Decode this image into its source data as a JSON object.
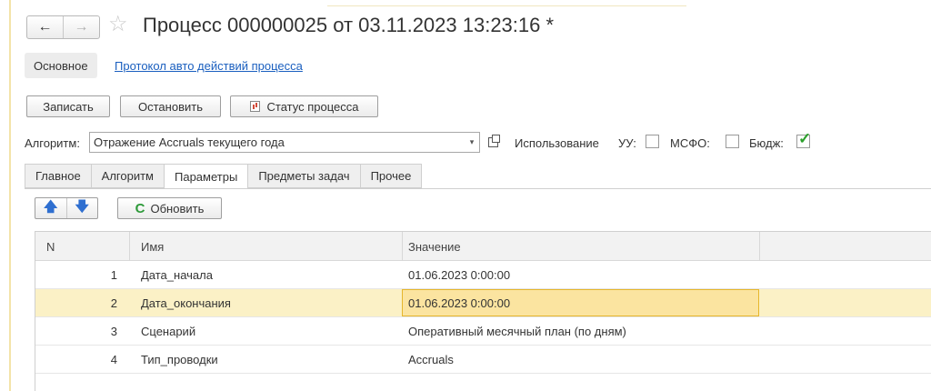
{
  "title_bar": {
    "back_glyph": "←",
    "forward_glyph": "→",
    "star_glyph": "☆",
    "title": "Процесс 000000025 от 03.11.2023 13:23:16 *"
  },
  "sections": {
    "main": "Основное",
    "log_link": "Протокол авто действий процесса"
  },
  "toolbar": {
    "save": "Записать",
    "stop": "Остановить",
    "status": "Статус процесса"
  },
  "algorithm": {
    "label": "Алгоритм:",
    "value": "Отражение Accruals текущего года",
    "dropdown_glyph": "▾"
  },
  "usage": {
    "label": "Использование",
    "uu_label": "УУ:",
    "uu_checked": false,
    "msfo_label": "МСФО:",
    "msfo_checked": false,
    "budget_label": "Бюдж:",
    "budget_checked": true,
    "check_glyph": "✓"
  },
  "tabs": [
    {
      "label": "Главное",
      "active": false
    },
    {
      "label": "Алгоритм",
      "active": false
    },
    {
      "label": "Параметры",
      "active": true
    },
    {
      "label": "Предметы задач",
      "active": false
    },
    {
      "label": "Прочее",
      "active": false
    }
  ],
  "panel_toolbar": {
    "up_glyph": "🡅",
    "down_glyph": "🡇",
    "refresh_glyph": "C",
    "refresh_label": "Обновить"
  },
  "grid": {
    "columns": [
      "N",
      "Имя",
      "Значение"
    ],
    "rows": [
      {
        "n": "1",
        "name": "Дата_начала",
        "value": "01.06.2023 0:00:00",
        "selected": false
      },
      {
        "n": "2",
        "name": "Дата_окончания",
        "value": "01.06.2023 0:00:00",
        "selected": true
      },
      {
        "n": "3",
        "name": "Сценарий",
        "value": "Оперативный месячный план (по дням)",
        "selected": false
      },
      {
        "n": "4",
        "name": "Тип_проводки",
        "value": "Accruals",
        "selected": false
      }
    ]
  },
  "colors": {
    "link": "#1a5fbf",
    "selected_row": "#fbf1c6",
    "selected_cell": "#fbe4a0",
    "selected_cell_border": "#e6b62c",
    "check": "#2ca02c",
    "arrow": "#2f6fd0",
    "refresh": "#2e9a3a"
  }
}
